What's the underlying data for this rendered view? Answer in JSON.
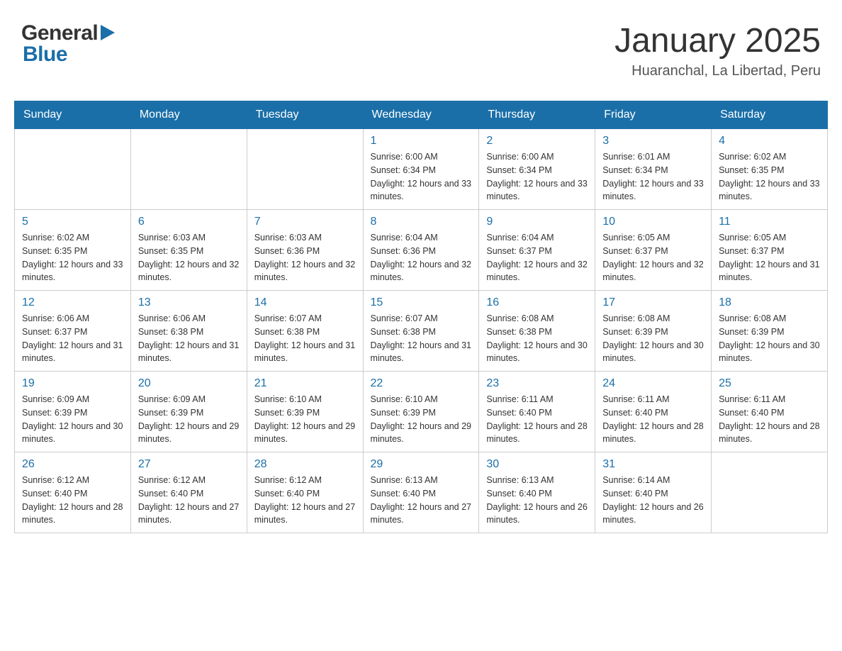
{
  "logo": {
    "general": "General",
    "blue": "Blue"
  },
  "title": "January 2025",
  "subtitle": "Huaranchal, La Libertad, Peru",
  "days": [
    "Sunday",
    "Monday",
    "Tuesday",
    "Wednesday",
    "Thursday",
    "Friday",
    "Saturday"
  ],
  "weeks": [
    [
      {
        "date": "",
        "info": ""
      },
      {
        "date": "",
        "info": ""
      },
      {
        "date": "",
        "info": ""
      },
      {
        "date": "1",
        "info": "Sunrise: 6:00 AM\nSunset: 6:34 PM\nDaylight: 12 hours and 33 minutes."
      },
      {
        "date": "2",
        "info": "Sunrise: 6:00 AM\nSunset: 6:34 PM\nDaylight: 12 hours and 33 minutes."
      },
      {
        "date": "3",
        "info": "Sunrise: 6:01 AM\nSunset: 6:34 PM\nDaylight: 12 hours and 33 minutes."
      },
      {
        "date": "4",
        "info": "Sunrise: 6:02 AM\nSunset: 6:35 PM\nDaylight: 12 hours and 33 minutes."
      }
    ],
    [
      {
        "date": "5",
        "info": "Sunrise: 6:02 AM\nSunset: 6:35 PM\nDaylight: 12 hours and 33 minutes."
      },
      {
        "date": "6",
        "info": "Sunrise: 6:03 AM\nSunset: 6:35 PM\nDaylight: 12 hours and 32 minutes."
      },
      {
        "date": "7",
        "info": "Sunrise: 6:03 AM\nSunset: 6:36 PM\nDaylight: 12 hours and 32 minutes."
      },
      {
        "date": "8",
        "info": "Sunrise: 6:04 AM\nSunset: 6:36 PM\nDaylight: 12 hours and 32 minutes."
      },
      {
        "date": "9",
        "info": "Sunrise: 6:04 AM\nSunset: 6:37 PM\nDaylight: 12 hours and 32 minutes."
      },
      {
        "date": "10",
        "info": "Sunrise: 6:05 AM\nSunset: 6:37 PM\nDaylight: 12 hours and 32 minutes."
      },
      {
        "date": "11",
        "info": "Sunrise: 6:05 AM\nSunset: 6:37 PM\nDaylight: 12 hours and 31 minutes."
      }
    ],
    [
      {
        "date": "12",
        "info": "Sunrise: 6:06 AM\nSunset: 6:37 PM\nDaylight: 12 hours and 31 minutes."
      },
      {
        "date": "13",
        "info": "Sunrise: 6:06 AM\nSunset: 6:38 PM\nDaylight: 12 hours and 31 minutes."
      },
      {
        "date": "14",
        "info": "Sunrise: 6:07 AM\nSunset: 6:38 PM\nDaylight: 12 hours and 31 minutes."
      },
      {
        "date": "15",
        "info": "Sunrise: 6:07 AM\nSunset: 6:38 PM\nDaylight: 12 hours and 31 minutes."
      },
      {
        "date": "16",
        "info": "Sunrise: 6:08 AM\nSunset: 6:38 PM\nDaylight: 12 hours and 30 minutes."
      },
      {
        "date": "17",
        "info": "Sunrise: 6:08 AM\nSunset: 6:39 PM\nDaylight: 12 hours and 30 minutes."
      },
      {
        "date": "18",
        "info": "Sunrise: 6:08 AM\nSunset: 6:39 PM\nDaylight: 12 hours and 30 minutes."
      }
    ],
    [
      {
        "date": "19",
        "info": "Sunrise: 6:09 AM\nSunset: 6:39 PM\nDaylight: 12 hours and 30 minutes."
      },
      {
        "date": "20",
        "info": "Sunrise: 6:09 AM\nSunset: 6:39 PM\nDaylight: 12 hours and 29 minutes."
      },
      {
        "date": "21",
        "info": "Sunrise: 6:10 AM\nSunset: 6:39 PM\nDaylight: 12 hours and 29 minutes."
      },
      {
        "date": "22",
        "info": "Sunrise: 6:10 AM\nSunset: 6:39 PM\nDaylight: 12 hours and 29 minutes."
      },
      {
        "date": "23",
        "info": "Sunrise: 6:11 AM\nSunset: 6:40 PM\nDaylight: 12 hours and 28 minutes."
      },
      {
        "date": "24",
        "info": "Sunrise: 6:11 AM\nSunset: 6:40 PM\nDaylight: 12 hours and 28 minutes."
      },
      {
        "date": "25",
        "info": "Sunrise: 6:11 AM\nSunset: 6:40 PM\nDaylight: 12 hours and 28 minutes."
      }
    ],
    [
      {
        "date": "26",
        "info": "Sunrise: 6:12 AM\nSunset: 6:40 PM\nDaylight: 12 hours and 28 minutes."
      },
      {
        "date": "27",
        "info": "Sunrise: 6:12 AM\nSunset: 6:40 PM\nDaylight: 12 hours and 27 minutes."
      },
      {
        "date": "28",
        "info": "Sunrise: 6:12 AM\nSunset: 6:40 PM\nDaylight: 12 hours and 27 minutes."
      },
      {
        "date": "29",
        "info": "Sunrise: 6:13 AM\nSunset: 6:40 PM\nDaylight: 12 hours and 27 minutes."
      },
      {
        "date": "30",
        "info": "Sunrise: 6:13 AM\nSunset: 6:40 PM\nDaylight: 12 hours and 26 minutes."
      },
      {
        "date": "31",
        "info": "Sunrise: 6:14 AM\nSunset: 6:40 PM\nDaylight: 12 hours and 26 minutes."
      },
      {
        "date": "",
        "info": ""
      }
    ]
  ]
}
